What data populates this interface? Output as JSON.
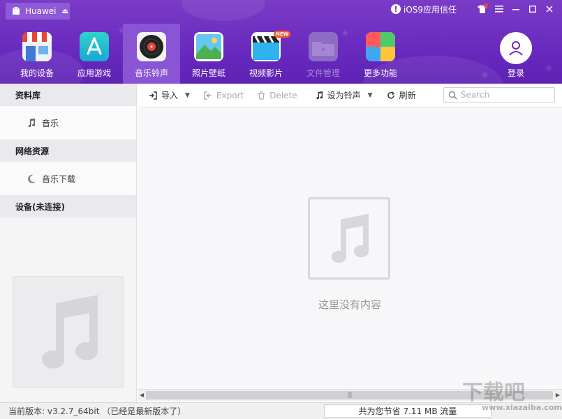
{
  "device": {
    "name": "Huawei",
    "eject_glyph": "⏏"
  },
  "header": {
    "trust_label": "iOS9应用信任",
    "trust_glyph": "!"
  },
  "nav": {
    "items": [
      {
        "label": "我的设备",
        "icon": "store-icon"
      },
      {
        "label": "应用游戏",
        "icon": "app-store-icon"
      },
      {
        "label": "音乐铃声",
        "icon": "vinyl-record-icon",
        "active": true
      },
      {
        "label": "照片壁纸",
        "icon": "photo-landscape-icon"
      },
      {
        "label": "视频影片",
        "icon": "clapperboard-icon",
        "badge": "NEW"
      },
      {
        "label": "文件管理",
        "icon": "folder-icon",
        "disabled": true
      },
      {
        "label": "更多功能",
        "icon": "tiles-icon"
      }
    ]
  },
  "login": {
    "label": "登录"
  },
  "sidebar": {
    "sections": [
      {
        "title": "资料库",
        "items": [
          {
            "label": "音乐",
            "icon": "music-note-icon"
          }
        ]
      },
      {
        "title": "网络资源",
        "items": [
          {
            "label": "音乐下载",
            "icon": "moon-icon"
          }
        ]
      },
      {
        "title": "设备(未连接)",
        "items": []
      }
    ]
  },
  "toolbar": {
    "import_label": "导入",
    "export_label": "Export",
    "delete_label": "Delete",
    "ringtone_label": "设为铃声",
    "refresh_label": "刷新",
    "search_placeholder": "Search"
  },
  "content": {
    "empty_text": "这里没有内容"
  },
  "status": {
    "version": "当前版本: v3.2.7_64bit （已经是最新版本了）",
    "saved": "共为您节省 7.11 MB 流量"
  },
  "watermark": {
    "main": "下载吧",
    "sub": "www.xiazaiba.com"
  },
  "colors": {
    "header": "#6a2bbf",
    "active_tab": "#8a55d4"
  }
}
